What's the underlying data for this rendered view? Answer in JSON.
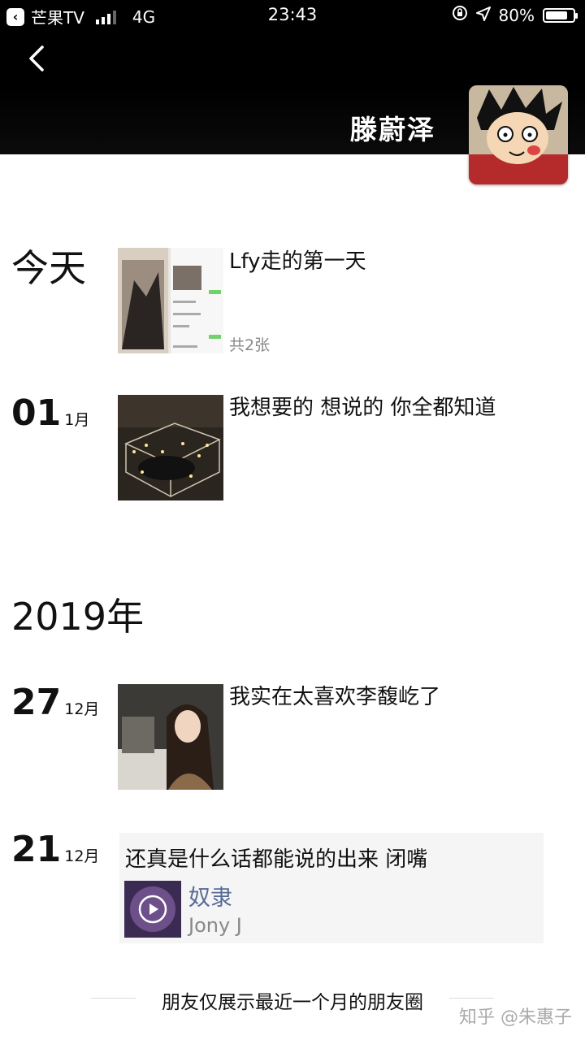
{
  "status_bar": {
    "carrier": "芒果TV",
    "network": "4G",
    "time": "23:43",
    "battery": "80%",
    "battery_level": 0.8
  },
  "profile": {
    "name": "滕蔚泽"
  },
  "sections": {
    "today_label": "今天",
    "year_label": "2019年"
  },
  "posts": [
    {
      "day": "",
      "month": "",
      "text": "Lfy走的第一天",
      "sub": "共2张"
    },
    {
      "day": "01",
      "month": "1月",
      "text": "我想要的 想说的 你全都知道"
    },
    {
      "day": "27",
      "month": "12月",
      "text": "我实在太喜欢李馥屹了"
    },
    {
      "day": "21",
      "month": "12月",
      "text": "还真是什么话都能说的出来 闭嘴",
      "music": {
        "title": "奴隶",
        "artist": "Jony J"
      }
    }
  ],
  "footer": {
    "text": "朋友仅展示最近一个月的朋友圈",
    "watermark": "知乎 @朱惠子"
  },
  "colors": {
    "header_bg": "#000000",
    "link_blue": "#576b95",
    "music_card_bg": "#f5f5f5"
  }
}
